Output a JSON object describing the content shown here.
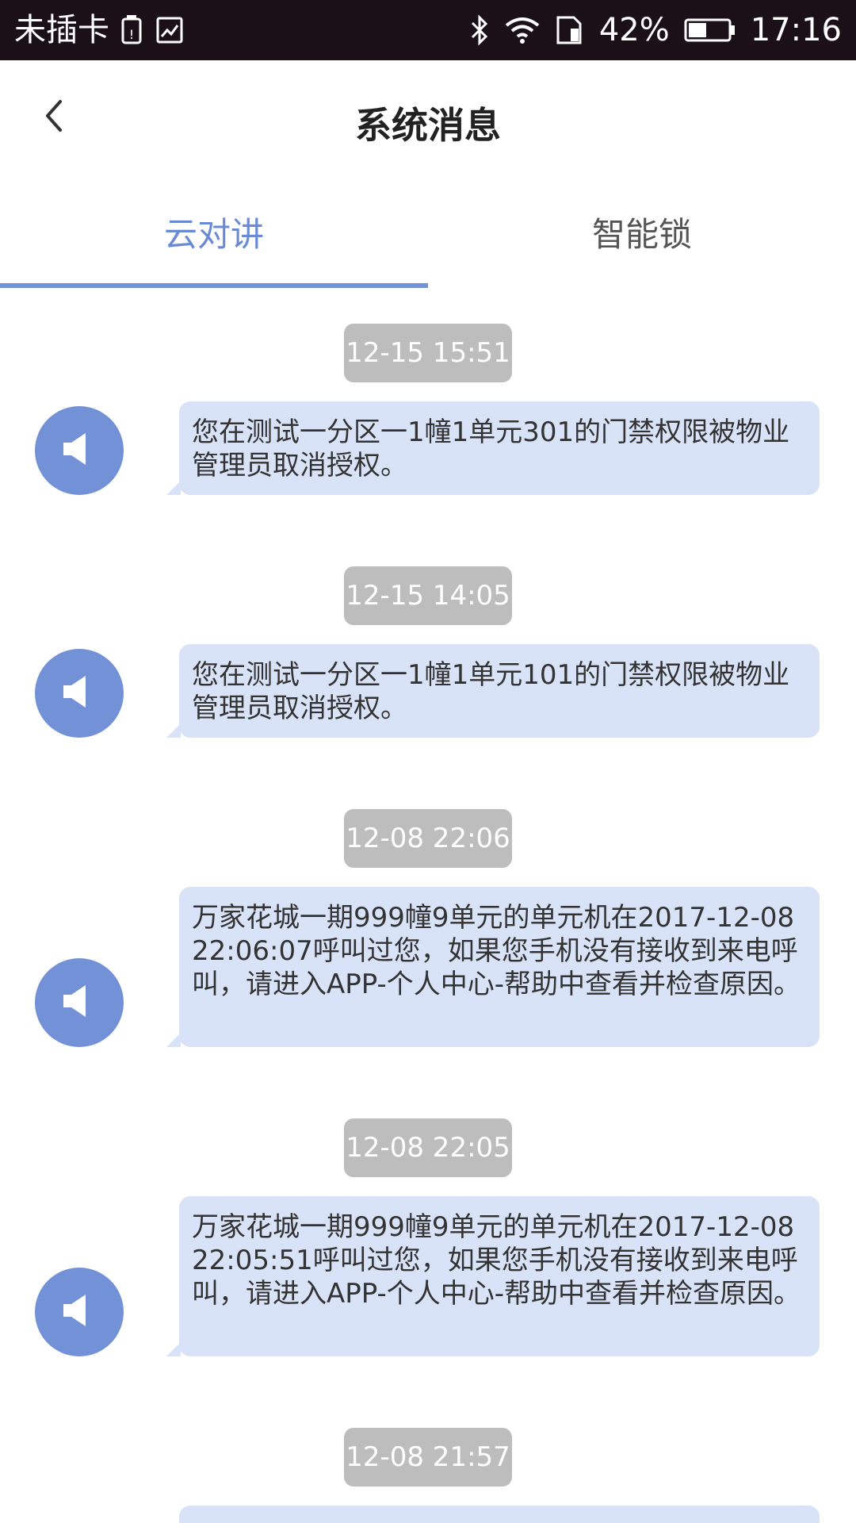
{
  "status_bar": {
    "carrier": "未插卡",
    "battery_percent": "42%",
    "time": "17:16",
    "icons": [
      "sim-warning-icon",
      "image-icon",
      "bluetooth-icon",
      "wifi-icon",
      "sim-card-icon",
      "battery-icon"
    ]
  },
  "header": {
    "title": "系统消息",
    "back_icon": "chevron-left-icon"
  },
  "tabs": [
    {
      "label": "云对讲",
      "active": true
    },
    {
      "label": "智能锁",
      "active": false
    }
  ],
  "colors": {
    "accent": "#7391d6",
    "bubble": "#d8e3f8",
    "timestamp_bg": "#bdbdbd"
  },
  "messages": [
    {
      "time": "12-15 15:51",
      "text": "您在测试一分区一1幢1单元301的门禁权限被物业管理员取消授权。",
      "icon": "speaker-icon"
    },
    {
      "time": "12-15 14:05",
      "text": "您在测试一分区一1幢1单元101的门禁权限被物业管理员取消授权。",
      "icon": "speaker-icon"
    },
    {
      "time": "12-08 22:06",
      "text": "万家花城一期999幢9单元的单元机在2017-12-08 22:06:07呼叫过您，如果您手机没有接收到来电呼叫，请进入APP-个人中心-帮助中查看并检查原因。",
      "icon": "speaker-icon"
    },
    {
      "time": "12-08 22:05",
      "text": "万家花城一期999幢9单元的单元机在2017-12-08 22:05:51呼叫过您，如果您手机没有接收到来电呼叫，请进入APP-个人中心-帮助中查看并检查原因。",
      "icon": "speaker-icon"
    },
    {
      "time": "12-08 21:57",
      "text": "",
      "icon": "speaker-icon"
    }
  ]
}
